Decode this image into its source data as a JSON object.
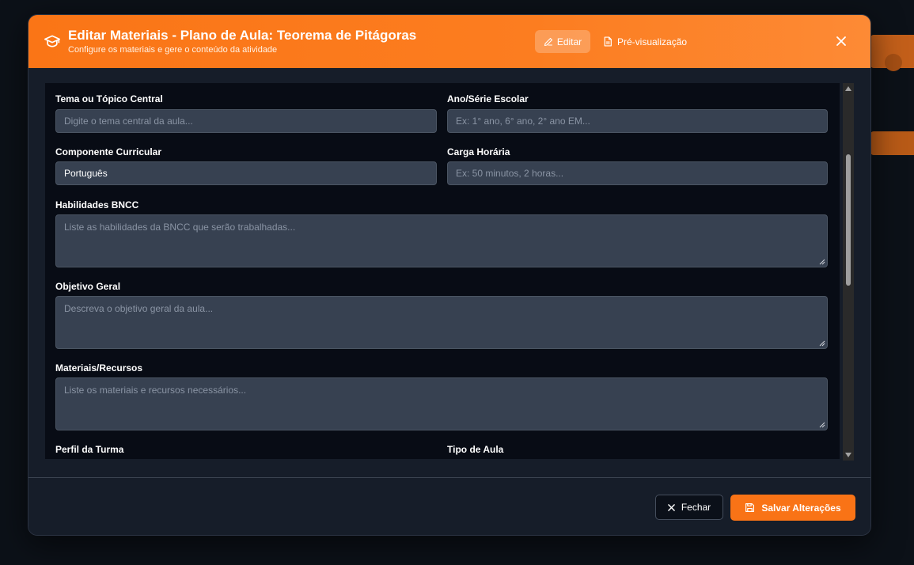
{
  "header": {
    "title": "Editar Materiais - Plano de Aula: Teorema de Pitágoras",
    "subtitle": "Configure os materiais e gere o conteúdo da atividade",
    "tab_edit": "Editar",
    "tab_preview": "Pré-visualização",
    "icon": "graduation-cap-icon"
  },
  "form": {
    "tema_label": "Tema ou Tópico Central",
    "tema_placeholder": "Digite o tema central da aula...",
    "ano_label": "Ano/Série Escolar",
    "ano_placeholder": "Ex: 1° ano, 6° ano, 2° ano EM...",
    "componente_label": "Componente Curricular",
    "componente_value": "Português",
    "carga_label": "Carga Horária",
    "carga_placeholder": "Ex: 50 minutos, 2 horas...",
    "bncc_label": "Habilidades BNCC",
    "bncc_placeholder": "Liste as habilidades da BNCC que serão trabalhadas...",
    "objetivo_label": "Objetivo Geral",
    "objetivo_placeholder": "Descreva o objetivo geral da aula...",
    "materiais_label": "Materiais/Recursos",
    "materiais_placeholder": "Liste os materiais e recursos necessários...",
    "perfil_label": "Perfil da Turma",
    "tipo_label": "Tipo de Aula"
  },
  "footer": {
    "close_label": "Fechar",
    "save_label": "Salvar Alterações"
  },
  "colors": {
    "accent": "#f97316",
    "header_gradient_start": "#fa7516",
    "panel_bg": "#080c15",
    "field_bg": "#374151"
  }
}
